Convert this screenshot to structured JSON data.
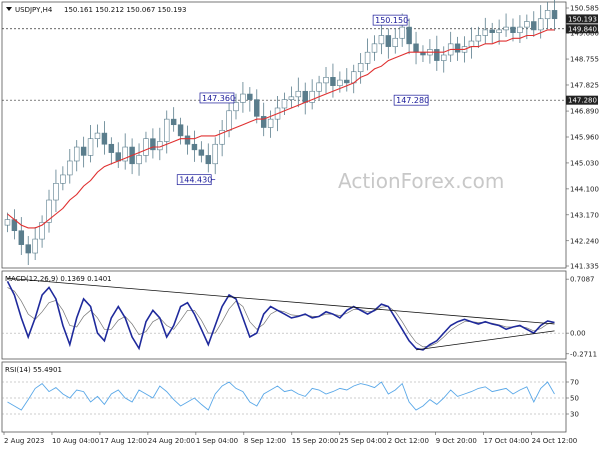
{
  "chart_data": {
    "type": "candlestick",
    "header": {
      "symbol": "USDJPY,H4",
      "ohlc": "150.161 150.212 150.067 150.193"
    },
    "watermark": "ActionForex.com",
    "colors": {
      "background": "#ffffff",
      "candle": "#5a7d8c",
      "sma": "#e03030",
      "macd": "#1f2a9c",
      "signal": "#777777",
      "rsi": "#5aa8e8",
      "trendline": "#111111",
      "annotation": "#1a1a99",
      "price_tag_bg": "#222222"
    },
    "x_ticks": [
      "2 Aug 2023",
      "10 Aug 04:00",
      "17 Aug 12:00",
      "24 Aug 20:00",
      "1 Sep 04:00",
      "8 Sep 12:00",
      "15 Sep 20:00",
      "25 Sep 04:00",
      "2 Oct 12:00",
      "9 Oct 20:00",
      "17 Oct 04:00",
      "24 Oct 12:00"
    ],
    "price_panel": {
      "y_ticks": [
        "150.585",
        "149.680",
        "148.755",
        "147.825",
        "146.890",
        "145.960",
        "145.030",
        "144.100",
        "143.170",
        "142.240",
        "141.335"
      ],
      "ylim": [
        141.335,
        150.585
      ],
      "closes": [
        143.0,
        142.6,
        142.1,
        141.8,
        142.3,
        142.9,
        143.7,
        144.3,
        144.6,
        145.1,
        145.6,
        145.3,
        145.9,
        146.1,
        145.7,
        145.4,
        145.1,
        145.6,
        145.0,
        145.3,
        145.9,
        145.5,
        145.8,
        146.6,
        146.4,
        146.0,
        145.7,
        145.5,
        145.3,
        145.0,
        145.7,
        146.2,
        146.9,
        147.2,
        147.5,
        147.3,
        146.7,
        146.3,
        146.6,
        147.0,
        147.3,
        147.4,
        147.6,
        147.2,
        147.6,
        147.9,
        148.1,
        147.8,
        148.0,
        147.9,
        148.3,
        148.6,
        149.0,
        149.3,
        149.6,
        149.2,
        149.5,
        149.9,
        149.3,
        149.0,
        148.9,
        149.1,
        148.7,
        148.9,
        149.3,
        149.0,
        149.2,
        149.4,
        149.6,
        149.8,
        149.7,
        149.8,
        149.9,
        149.7,
        149.9,
        150.1,
        149.8,
        150.2,
        150.5,
        150.2
      ],
      "sma": [
        143.2,
        143.0,
        142.8,
        142.7,
        142.7,
        142.8,
        143.0,
        143.2,
        143.4,
        143.7,
        143.9,
        144.2,
        144.4,
        144.7,
        144.9,
        145.0,
        145.1,
        145.2,
        145.3,
        145.4,
        145.5,
        145.6,
        145.6,
        145.7,
        145.8,
        145.9,
        145.9,
        145.9,
        146.0,
        146.0,
        146.0,
        146.1,
        146.2,
        146.3,
        146.4,
        146.5,
        146.6,
        146.6,
        146.7,
        146.8,
        146.9,
        147.0,
        147.1,
        147.2,
        147.3,
        147.4,
        147.5,
        147.6,
        147.7,
        147.8,
        147.9,
        148.1,
        148.2,
        148.4,
        148.5,
        148.7,
        148.8,
        148.9,
        149.0,
        149.0,
        149.0,
        149.0,
        149.0,
        149.0,
        149.1,
        149.1,
        149.1,
        149.2,
        149.2,
        149.3,
        149.3,
        149.4,
        149.4,
        149.5,
        149.5,
        149.6,
        149.6,
        149.7,
        149.8,
        149.8
      ],
      "h_lines": [
        149.84,
        147.28
      ],
      "right_tags": [
        {
          "text": "150.193",
          "value": 150.193
        },
        {
          "text": "149.840",
          "value": 149.84
        },
        {
          "text": "147.280",
          "value": 147.28
        }
      ],
      "annotations": [
        {
          "text": "147.360",
          "value": 147.36,
          "bar": 33
        },
        {
          "text": "144.430",
          "value": 144.43,
          "bar": 30
        },
        {
          "text": "150.150",
          "value": 150.15,
          "bar": 58
        },
        {
          "text": "147.280",
          "value": 147.28,
          "bar": 58
        }
      ]
    },
    "macd_panel": {
      "label": "MACD(12,26,9) 0.1369 0.1401",
      "y_ticks": [
        "0.7087",
        "0.00",
        "-0.2711"
      ],
      "ylim": [
        -0.3,
        0.75
      ],
      "macd": [
        0.68,
        0.5,
        0.2,
        -0.05,
        0.2,
        0.5,
        0.6,
        0.45,
        0.1,
        -0.15,
        0.2,
        0.45,
        0.35,
        0.0,
        -0.1,
        0.2,
        0.35,
        0.2,
        -0.05,
        -0.2,
        0.15,
        0.3,
        0.2,
        -0.05,
        0.1,
        0.35,
        0.4,
        0.25,
        0.05,
        -0.15,
        0.1,
        0.35,
        0.5,
        0.45,
        0.2,
        -0.05,
        0.0,
        0.25,
        0.35,
        0.3,
        0.25,
        0.2,
        0.22,
        0.25,
        0.2,
        0.22,
        0.28,
        0.25,
        0.2,
        0.3,
        0.35,
        0.3,
        0.25,
        0.3,
        0.38,
        0.35,
        0.2,
        0.05,
        -0.1,
        -0.2,
        -0.22,
        -0.15,
        -0.1,
        0.0,
        0.1,
        0.15,
        0.18,
        0.15,
        0.12,
        0.15,
        0.12,
        0.1,
        0.05,
        0.08,
        0.1,
        0.05,
        0.0,
        0.1,
        0.16,
        0.14
      ],
      "signal": [
        0.6,
        0.55,
        0.42,
        0.25,
        0.18,
        0.28,
        0.4,
        0.43,
        0.3,
        0.1,
        0.08,
        0.22,
        0.3,
        0.2,
        0.05,
        0.05,
        0.17,
        0.22,
        0.12,
        -0.02,
        0.02,
        0.15,
        0.2,
        0.1,
        0.05,
        0.17,
        0.3,
        0.3,
        0.17,
        0.0,
        0.0,
        0.15,
        0.32,
        0.42,
        0.35,
        0.15,
        0.05,
        0.12,
        0.25,
        0.3,
        0.28,
        0.24,
        0.23,
        0.24,
        0.22,
        0.22,
        0.25,
        0.25,
        0.23,
        0.26,
        0.31,
        0.31,
        0.28,
        0.29,
        0.34,
        0.35,
        0.28,
        0.15,
        0.0,
        -0.12,
        -0.18,
        -0.17,
        -0.13,
        -0.05,
        0.04,
        0.1,
        0.15,
        0.15,
        0.14,
        0.14,
        0.13,
        0.11,
        0.08,
        0.08,
        0.09,
        0.07,
        0.03,
        0.06,
        0.12,
        0.14
      ],
      "trendlines": [
        {
          "from": [
            0,
            0.72
          ],
          "to": [
            79,
            0.12
          ]
        },
        {
          "from": [
            59,
            -0.22
          ],
          "to": [
            79,
            0.03
          ]
        }
      ]
    },
    "rsi_panel": {
      "label": "RSI(14) 55.4901",
      "y_ticks": [
        "70",
        "50",
        "30"
      ],
      "ylim": [
        10,
        90
      ],
      "levels": [
        70,
        50,
        30
      ],
      "values": [
        45,
        40,
        35,
        48,
        62,
        68,
        58,
        63,
        55,
        50,
        60,
        58,
        45,
        52,
        42,
        55,
        60,
        50,
        45,
        60,
        55,
        50,
        65,
        58,
        48,
        40,
        45,
        50,
        42,
        35,
        55,
        65,
        70,
        62,
        58,
        45,
        40,
        55,
        60,
        65,
        58,
        60,
        55,
        52,
        62,
        60,
        55,
        58,
        62,
        60,
        65,
        68,
        66,
        63,
        70,
        55,
        60,
        68,
        45,
        35,
        40,
        48,
        42,
        50,
        60,
        52,
        55,
        58,
        62,
        64,
        58,
        60,
        62,
        55,
        60,
        64,
        45,
        62,
        70,
        55
      ]
    }
  }
}
